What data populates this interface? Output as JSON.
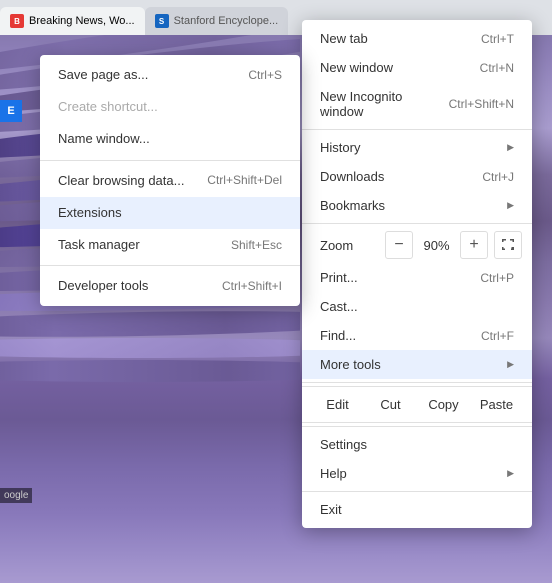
{
  "tabs": [
    {
      "id": "tab1",
      "title": "Breaking News, Wo...",
      "favicon_color": "#e53935",
      "active": true
    },
    {
      "id": "tab2",
      "title": "Stanford Encyclope...",
      "favicon_color": "#1565c0",
      "active": false
    }
  ],
  "left_menu": {
    "items": [
      {
        "id": "save-page",
        "label": "Save page as...",
        "shortcut": "Ctrl+S",
        "disabled": false,
        "submenu": false
      },
      {
        "id": "create-shortcut",
        "label": "Create shortcut...",
        "shortcut": "",
        "disabled": false,
        "submenu": false
      },
      {
        "id": "name-window",
        "label": "Name window...",
        "shortcut": "",
        "disabled": false,
        "submenu": false
      },
      {
        "id": "sep1",
        "type": "separator"
      },
      {
        "id": "clear-browsing",
        "label": "Clear browsing data...",
        "shortcut": "Ctrl+Shift+Del",
        "disabled": false,
        "submenu": false
      },
      {
        "id": "extensions",
        "label": "Extensions",
        "shortcut": "",
        "disabled": false,
        "submenu": false,
        "highlighted": true
      },
      {
        "id": "task-manager",
        "label": "Task manager",
        "shortcut": "Shift+Esc",
        "disabled": false,
        "submenu": false
      },
      {
        "id": "sep2",
        "type": "separator"
      },
      {
        "id": "developer-tools",
        "label": "Developer tools",
        "shortcut": "Ctrl+Shift+I",
        "disabled": false,
        "submenu": false
      }
    ]
  },
  "right_menu": {
    "items": [
      {
        "id": "new-tab",
        "label": "New tab",
        "shortcut": "Ctrl+T",
        "submenu": false
      },
      {
        "id": "new-window",
        "label": "New window",
        "shortcut": "Ctrl+N",
        "submenu": false
      },
      {
        "id": "new-incognito",
        "label": "New Incognito window",
        "shortcut": "Ctrl+Shift+N",
        "submenu": false
      },
      {
        "id": "sep1",
        "type": "separator"
      },
      {
        "id": "history",
        "label": "History",
        "shortcut": "",
        "submenu": true
      },
      {
        "id": "downloads",
        "label": "Downloads",
        "shortcut": "Ctrl+J",
        "submenu": false
      },
      {
        "id": "bookmarks",
        "label": "Bookmarks",
        "shortcut": "",
        "submenu": true
      },
      {
        "id": "sep2",
        "type": "separator"
      },
      {
        "id": "zoom",
        "label": "Zoom",
        "value": "90%",
        "type": "zoom"
      },
      {
        "id": "print",
        "label": "Print...",
        "shortcut": "Ctrl+P",
        "submenu": false
      },
      {
        "id": "cast",
        "label": "Cast...",
        "shortcut": "",
        "submenu": false
      },
      {
        "id": "find",
        "label": "Find...",
        "shortcut": "Ctrl+F",
        "submenu": false
      },
      {
        "id": "more-tools",
        "label": "More tools",
        "shortcut": "",
        "submenu": true,
        "highlighted": true
      },
      {
        "id": "sep3",
        "type": "separator"
      },
      {
        "id": "edit-row",
        "type": "edit-row",
        "items": [
          "Edit",
          "Cut",
          "Copy",
          "Paste"
        ]
      },
      {
        "id": "sep4",
        "type": "separator"
      },
      {
        "id": "settings",
        "label": "Settings",
        "shortcut": "",
        "submenu": false
      },
      {
        "id": "help",
        "label": "Help",
        "shortcut": "",
        "submenu": true
      },
      {
        "id": "sep5",
        "type": "separator"
      },
      {
        "id": "exit",
        "label": "Exit",
        "shortcut": "",
        "submenu": false
      }
    ]
  },
  "ext_badge": {
    "letter": "E"
  },
  "bottom_badge": {
    "text": "oogle"
  }
}
